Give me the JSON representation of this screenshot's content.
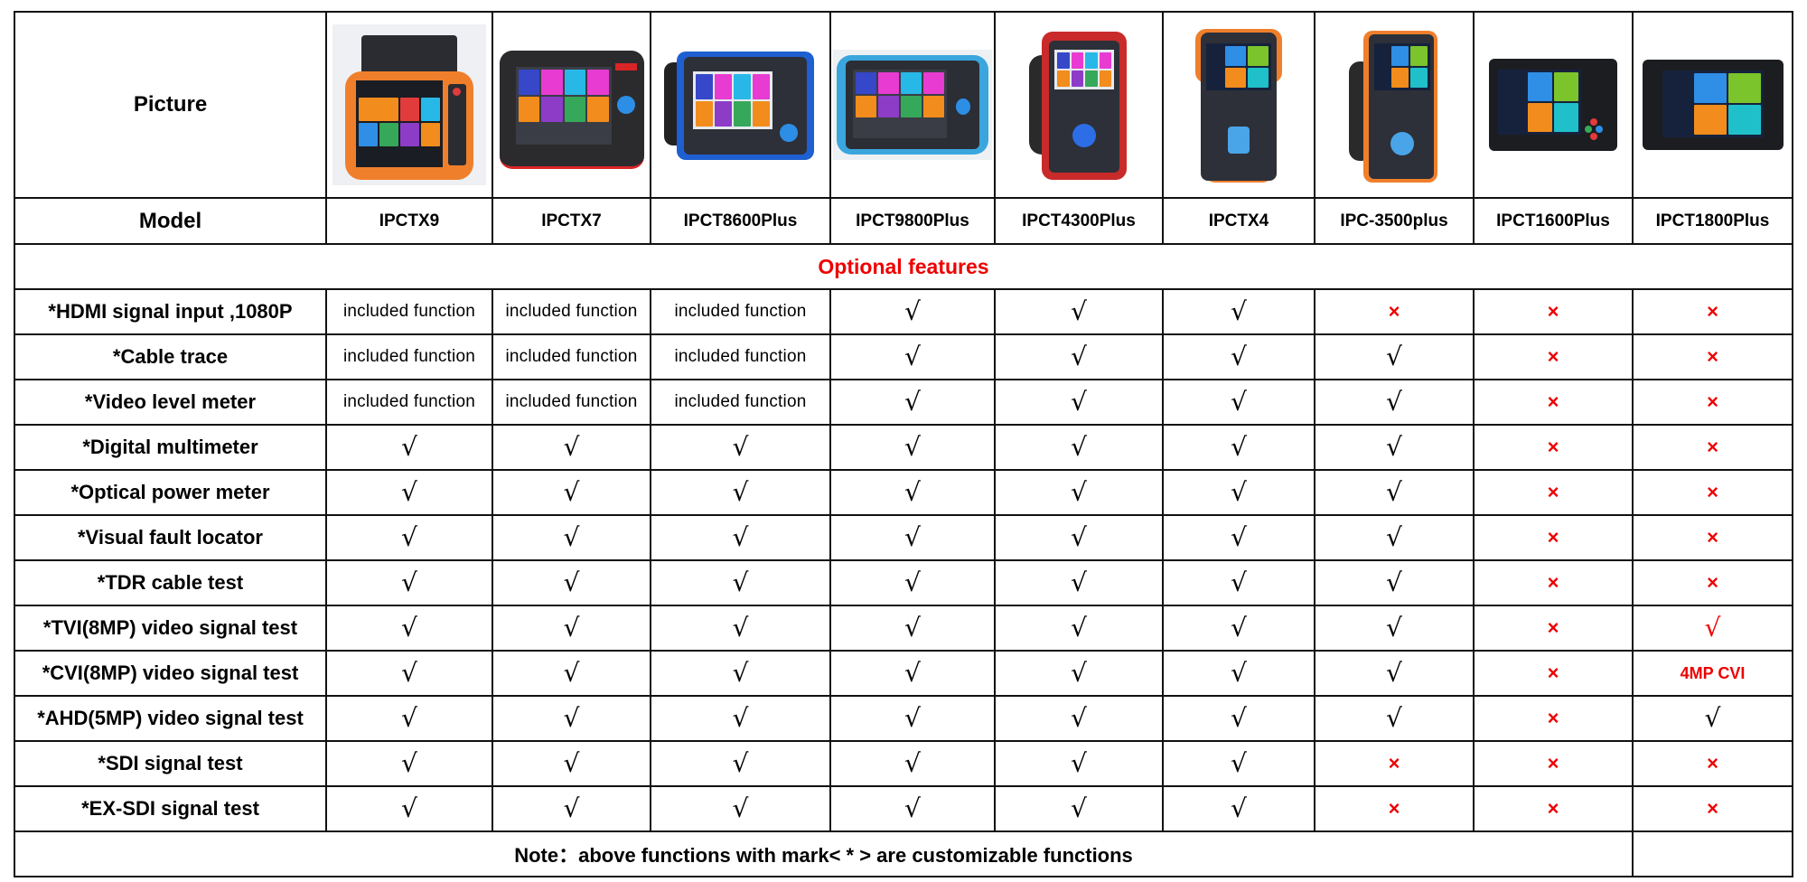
{
  "table": {
    "picture_label": "Picture",
    "model_label": "Model",
    "models": [
      {
        "name": "IPCTX9",
        "image": "device-ipctx9"
      },
      {
        "name": "IPCTX7",
        "image": "device-ipctx7"
      },
      {
        "name": "IPCT8600Plus",
        "image": "device-ipct8600plus"
      },
      {
        "name": "IPCT9800Plus",
        "image": "device-ipct9800plus"
      },
      {
        "name": "IPCT4300Plus",
        "image": "device-ipct4300plus"
      },
      {
        "name": "IPCTX4",
        "image": "device-ipctx4"
      },
      {
        "name": "IPC-3500plus",
        "image": "device-ipc3500plus"
      },
      {
        "name": "IPCT1600Plus",
        "image": "device-ipct1600plus"
      },
      {
        "name": "IPCT1800Plus",
        "image": "device-ipct1800plus"
      }
    ],
    "section_title": "Optional features",
    "section_color": "#ee0000",
    "symbols": {
      "check": "√",
      "cross": "×"
    },
    "features": [
      {
        "label": "*HDMI signal input ,1080P",
        "values": [
          "included function",
          "included function",
          "included function",
          "check",
          "check",
          "check",
          "cross",
          "cross",
          "cross"
        ]
      },
      {
        "label": "*Cable trace",
        "values": [
          "included function",
          "included function",
          "included function",
          "check",
          "check",
          "check",
          "check",
          "cross",
          "cross"
        ]
      },
      {
        "label": "*Video level meter",
        "values": [
          "included function",
          "included function",
          "included function",
          "check",
          "check",
          "check",
          "check",
          "cross",
          "cross"
        ]
      },
      {
        "label": "*Digital multimeter",
        "values": [
          "check",
          "check",
          "check",
          "check",
          "check",
          "check",
          "check",
          "cross",
          "cross"
        ]
      },
      {
        "label": "*Optical power meter",
        "values": [
          "check",
          "check",
          "check",
          "check",
          "check",
          "check",
          "check",
          "cross",
          "cross"
        ]
      },
      {
        "label": "*Visual fault locator",
        "values": [
          "check",
          "check",
          "check",
          "check",
          "check",
          "check",
          "check",
          "cross",
          "cross"
        ]
      },
      {
        "label": "*TDR cable test",
        "values": [
          "check",
          "check",
          "check",
          "check",
          "check",
          "check",
          "check",
          "cross",
          "cross"
        ]
      },
      {
        "label": "*TVI(8MP) video signal test",
        "values": [
          "check",
          "check",
          "check",
          "check",
          "check",
          "check",
          "check",
          "cross",
          "check-red"
        ]
      },
      {
        "label": "*CVI(8MP) video signal test",
        "values": [
          "check",
          "check",
          "check",
          "check",
          "check",
          "check",
          "check",
          "cross",
          "4MP CVI"
        ]
      },
      {
        "label": "*AHD(5MP) video signal test",
        "values": [
          "check",
          "check",
          "check",
          "check",
          "check",
          "check",
          "check",
          "cross",
          "check"
        ]
      },
      {
        "label": "*SDI signal test",
        "values": [
          "check",
          "check",
          "check",
          "check",
          "check",
          "check",
          "cross",
          "cross",
          "cross"
        ]
      },
      {
        "label": "*EX-SDI signal test",
        "values": [
          "check",
          "check",
          "check",
          "check",
          "check",
          "check",
          "cross",
          "cross",
          "cross"
        ]
      }
    ],
    "note": "Note：above functions with mark< * > are customizable functions"
  }
}
